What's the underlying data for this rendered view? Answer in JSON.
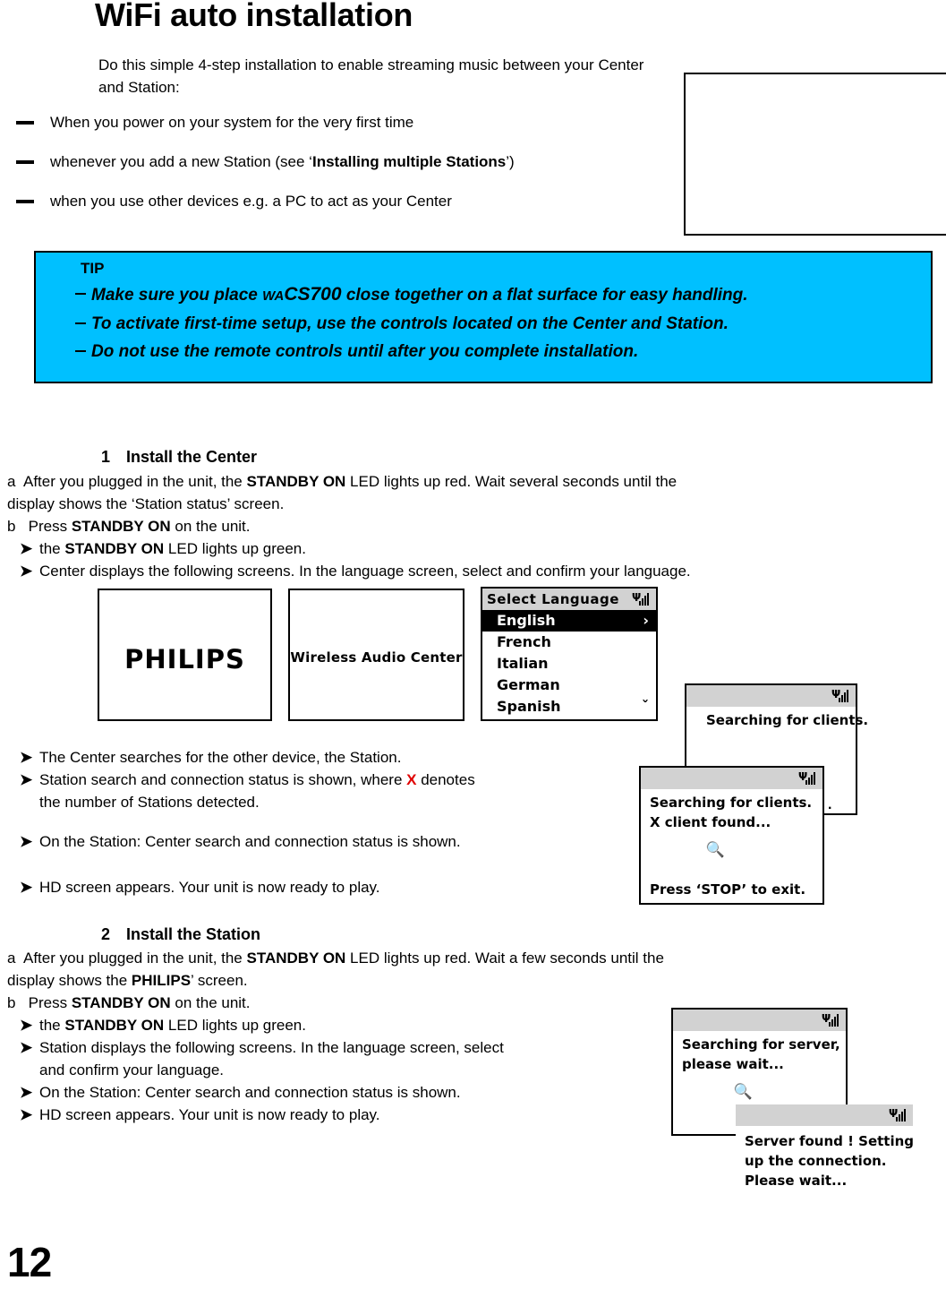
{
  "page": {
    "title": "WiFi auto installation",
    "number": "12"
  },
  "intro": {
    "text": "Do this simple 4-step installation to enable streaming music between your Center and Station:"
  },
  "bullets": [
    {
      "text_before": "When you power on your system for the very first time",
      "bold": "",
      "text_after": ""
    },
    {
      "text_before": "whenever you add a new Station (see ‘",
      "bold": "Installing multiple Stations",
      "text_after": "’)"
    },
    {
      "text_before": "when you use other devices e.g. a PC to act as your Center",
      "bold": "",
      "text_after": ""
    }
  ],
  "tip": {
    "heading": "TIP",
    "line1_a": "Make sure you place ",
    "line1_wa": "WA",
    "line1_cs": "CS700",
    "line1_b": " close together on a flat surface for easy handling.",
    "line2": "To activate first-time setup, use the controls located on the Center and Station.",
    "line3": "Do not use the remote controls until after you complete installation.",
    "bg_color": "#00C0FF"
  },
  "step1": {
    "number": "1",
    "heading": "Install the Center",
    "a_label": "a",
    "a_line1_pre": "After you plugged in the unit, the ",
    "a_line1_bold": "STANDBY ON",
    "a_line1_post": " LED lights up red. Wait several seconds until the",
    "a_line2": "display shows the ‘Station status’ screen.",
    "b_label": "b",
    "b_pre": "Press ",
    "b_bold": "STANDBY ON",
    "b_post": " on the unit.",
    "arrow1_pre": "the ",
    "arrow1_bold": "STANDBY ON",
    "arrow1_post": " LED lights up green.",
    "arrow2": "Center displays the following screens. In the language screen, select and confirm your language.",
    "arrow3": "The Center searches for the other device, the Station.",
    "arrow4_pre": "Station search and connection status is shown, where ",
    "arrow4_x": "X",
    "arrow4_post": " denotes",
    "arrow4_line2": "the number of Stations detected.",
    "arrow5": "On the Station: Center search and connection status is shown.",
    "arrow6": "HD screen appears. Your unit is now ready to play."
  },
  "step2": {
    "number": "2",
    "heading": "Install the Station",
    "a_label": "a",
    "a_line1_pre": "After you plugged in the unit, the ",
    "a_line1_bold": "STANDBY ON",
    "a_line1_post": " LED lights up red. Wait a few seconds until the",
    "a_line2_pre": "display shows the ",
    "a_line2_bold": "PHILIPS",
    "a_line2_post": "’ screen.",
    "b_label": "b",
    "b_pre": "Press ",
    "b_bold": "STANDBY ON",
    "b_post": " on the unit.",
    "arrow1_pre": "the ",
    "arrow1_bold": "STANDBY ON",
    "arrow1_post": " LED lights up green.",
    "arrow2_line1": "Station displays the following screens. In the language screen, select",
    "arrow2_line2": "and confirm your language.",
    "arrow3": "On the Station: Center search and connection status is shown.",
    "arrow4": "HD screen appears. Your unit is now ready to play."
  },
  "screens": {
    "philips": {
      "label": "PHILIPS"
    },
    "wireless_audio_center": {
      "label": "Wireless Audio Center"
    },
    "select_language": {
      "title": "Select Language",
      "signal_icon": "signal-bars-icon",
      "items": [
        {
          "label": "English",
          "selected": true,
          "marker": "›"
        },
        {
          "label": "French",
          "selected": false,
          "marker": ""
        },
        {
          "label": "Italian",
          "selected": false,
          "marker": ""
        },
        {
          "label": "German",
          "selected": false,
          "marker": ""
        },
        {
          "label": "Spanish",
          "selected": false,
          "marker": "ˇ"
        }
      ]
    },
    "searching_clients": {
      "line1": "Searching for clients."
    },
    "searching_clients_found": {
      "line1": "Searching for clients.",
      "line2": "X client found...",
      "magnifier_icon": "magnifier-icon",
      "footer": "Press ‘STOP’ to exit.",
      "stray_dot": "."
    },
    "searching_server": {
      "line1": "Searching for server,",
      "line2": "please wait...",
      "magnifier_icon": "magnifier-icon"
    },
    "server_found": {
      "line1": "Server found ! Setting",
      "line2": "up the connection.",
      "line3": "Please wait..."
    }
  }
}
